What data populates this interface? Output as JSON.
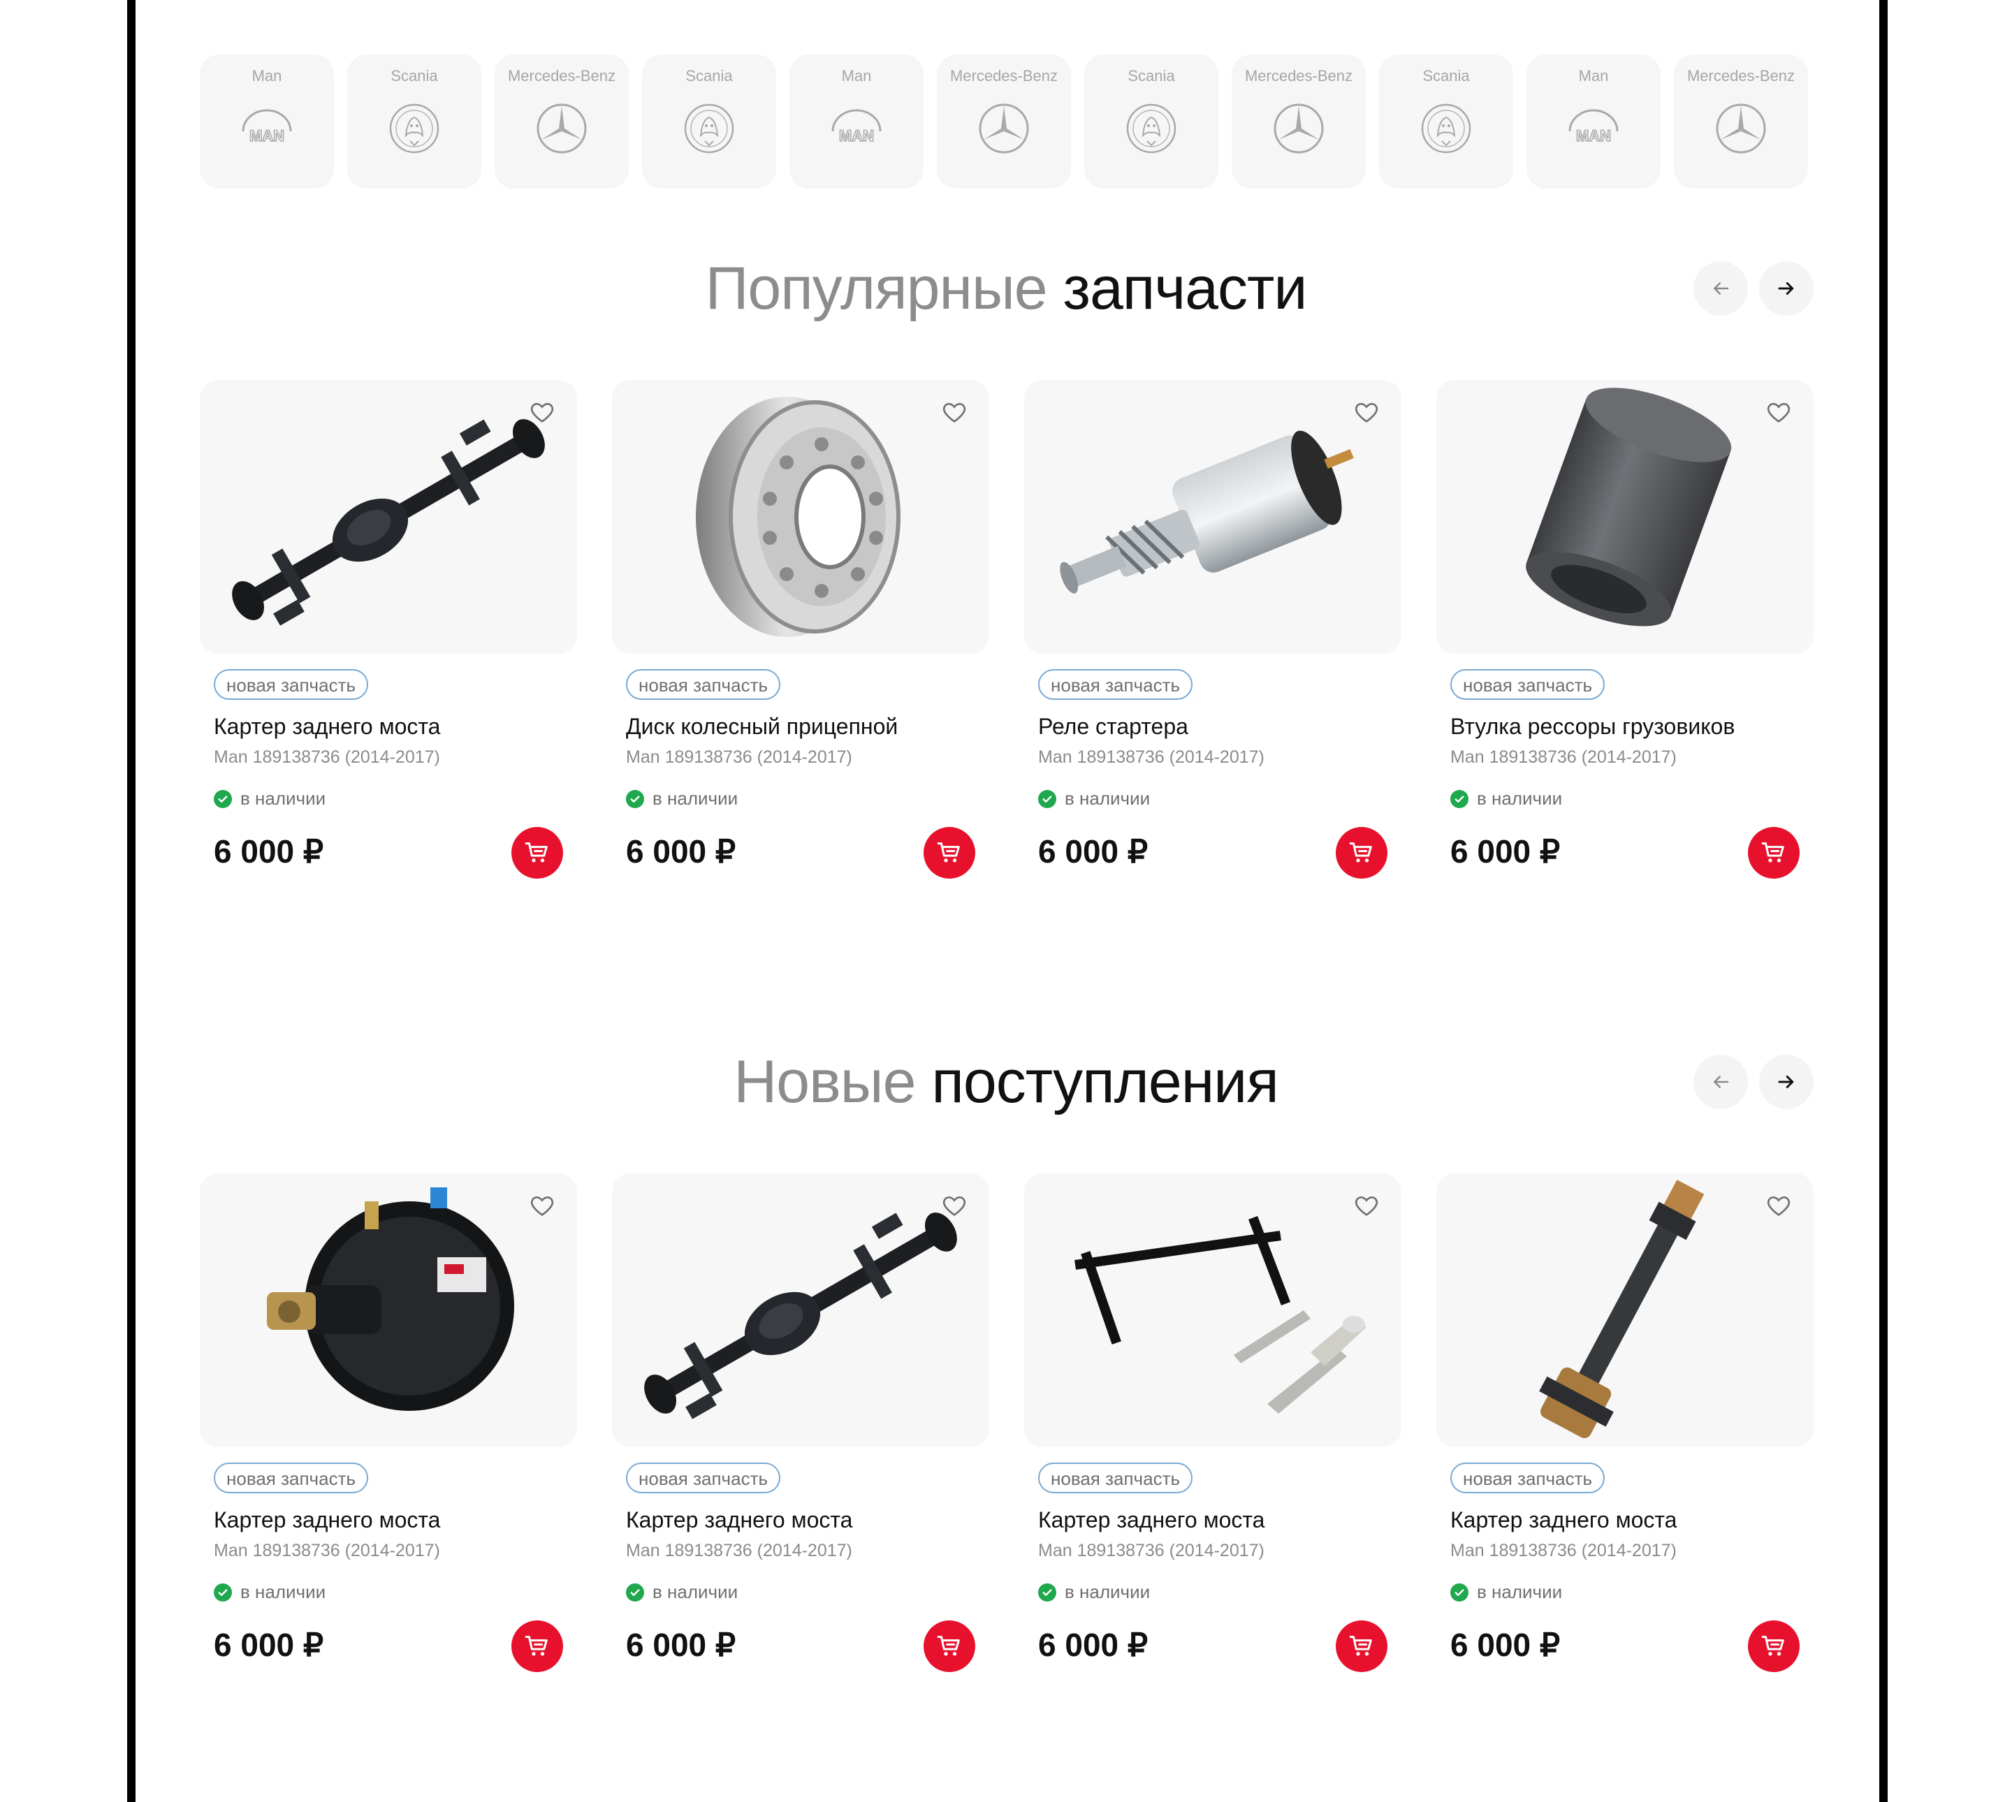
{
  "brands": [
    {
      "name": "Man",
      "logo": "man-logo"
    },
    {
      "name": "Scania",
      "logo": "scania-logo"
    },
    {
      "name": "Mercedes-Benz",
      "logo": "mercedes-logo"
    },
    {
      "name": "Scania",
      "logo": "scania-logo"
    },
    {
      "name": "Man",
      "logo": "man-logo"
    },
    {
      "name": "Mercedes-Benz",
      "logo": "mercedes-logo"
    },
    {
      "name": "Scania",
      "logo": "scania-logo"
    },
    {
      "name": "Mercedes-Benz",
      "logo": "mercedes-logo"
    },
    {
      "name": "Scania",
      "logo": "scania-logo"
    },
    {
      "name": "Man",
      "logo": "man-logo"
    },
    {
      "name": "Mercedes-Benz",
      "logo": "mercedes-logo"
    }
  ],
  "popular": {
    "title_light": "Популярные",
    "title_dark": "запчасти",
    "products": [
      {
        "badge": "новая запчасть",
        "name": "Картер заднего моста",
        "sub": "Man 189138736 (2014-2017)",
        "stock": "в наличии",
        "price": "6 000 ₽",
        "image": "axle"
      },
      {
        "badge": "новая запчасть",
        "name": "Диск колесный прицепной",
        "sub": "Man 189138736 (2014-2017)",
        "stock": "в наличии",
        "price": "6 000 ₽",
        "image": "wheel-rim"
      },
      {
        "badge": "новая запчасть",
        "name": "Реле стартера",
        "sub": "Man 189138736 (2014-2017)",
        "stock": "в наличии",
        "price": "6 000 ₽",
        "image": "starter-relay"
      },
      {
        "badge": "новая запчасть",
        "name": "Втулка рессоры грузовиков",
        "sub": "Man 189138736 (2014-2017)",
        "stock": "в наличии",
        "price": "6 000 ₽",
        "image": "bushing"
      }
    ]
  },
  "new_arrivals": {
    "title_light": "Новые",
    "title_dark": "поступления",
    "products": [
      {
        "badge": "новая запчасть",
        "name": "Картер заднего моста",
        "sub": "Man 189138736 (2014-2017)",
        "stock": "в наличии",
        "price": "6 000 ₽",
        "image": "brake-chamber"
      },
      {
        "badge": "новая запчасть",
        "name": "Картер заднего моста",
        "sub": "Man 189138736 (2014-2017)",
        "stock": "в наличии",
        "price": "6 000 ₽",
        "image": "axle"
      },
      {
        "badge": "новая запчасть",
        "name": "Картер заднего моста",
        "sub": "Man 189138736 (2014-2017)",
        "stock": "в наличии",
        "price": "6 000 ₽",
        "image": "bracket-kit"
      },
      {
        "badge": "новая запчасть",
        "name": "Картер заднего моста",
        "sub": "Man 189138736 (2014-2017)",
        "stock": "в наличии",
        "price": "6 000 ₽",
        "image": "drive-shaft"
      }
    ]
  }
}
